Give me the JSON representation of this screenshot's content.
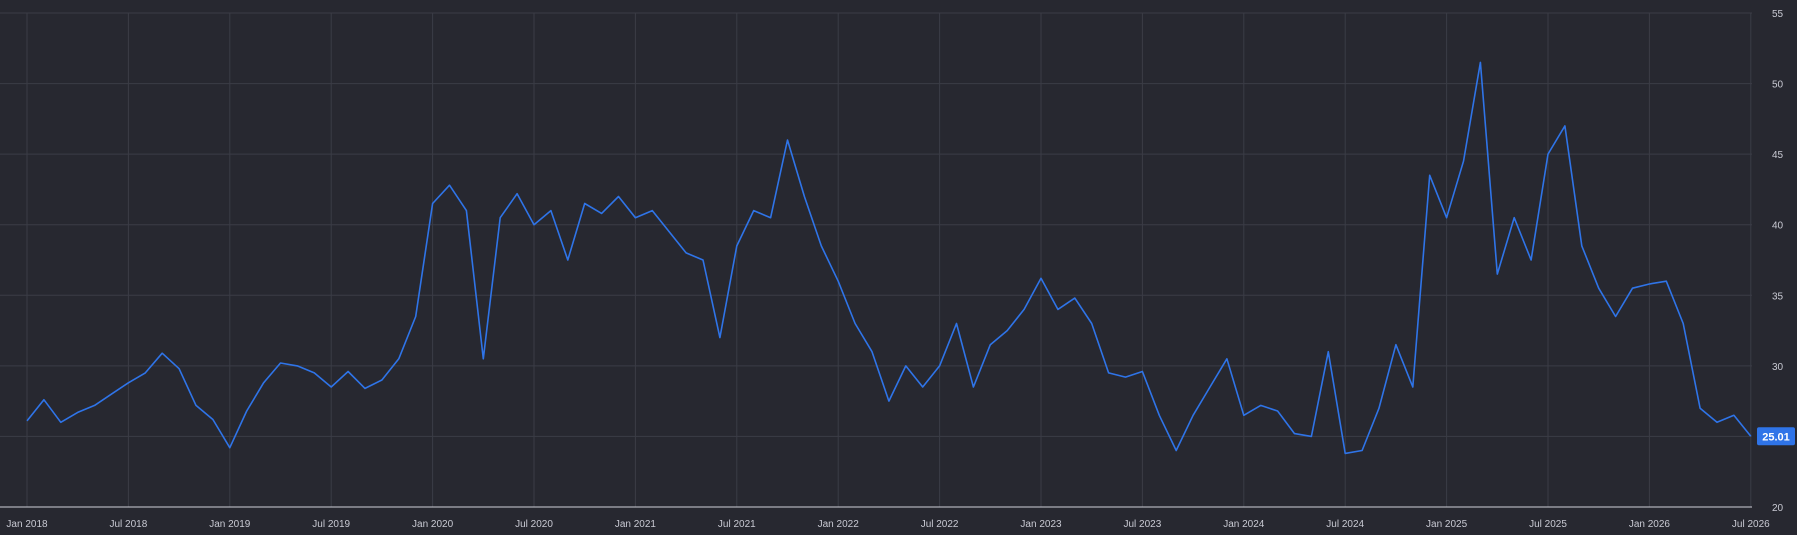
{
  "chart_data": {
    "type": "line",
    "colors": {
      "background": "#272830",
      "line": "#2f74e8",
      "grid": "#3b3c46",
      "badge": "#2f74e8"
    },
    "grid": true,
    "y_axis_position": "right",
    "ylim": [
      20,
      55
    ],
    "y_ticks": [
      "20",
      "25",
      "30",
      "35",
      "40",
      "45",
      "50",
      "55"
    ],
    "x_ticks": [
      "Jan 2018",
      "Jul 2018",
      "Jan 2019",
      "Jul 2019",
      "Jan 2020",
      "Jul 2020",
      "Jan 2021",
      "Jul 2021",
      "Jan 2022",
      "Jul 2022",
      "Jan 2023",
      "Jul 2023",
      "Jan 2024",
      "Jul 2024",
      "Jan 2025",
      "Jul 2025",
      "Jan 2026",
      "Jul 2026"
    ],
    "last_value_label": "25.01",
    "series": [
      {
        "values": [
          [
            "2018-01",
            26.1
          ],
          [
            "2018-02",
            27.6
          ],
          [
            "2018-03",
            26.0
          ],
          [
            "2018-04",
            26.7
          ],
          [
            "2018-05",
            27.2
          ],
          [
            "2018-06",
            28.0
          ],
          [
            "2018-07",
            28.8
          ],
          [
            "2018-08",
            29.5
          ],
          [
            "2018-09",
            30.9
          ],
          [
            "2018-10",
            29.8
          ],
          [
            "2018-11",
            27.2
          ],
          [
            "2018-12",
            26.2
          ],
          [
            "2019-01",
            24.2
          ],
          [
            "2019-02",
            26.8
          ],
          [
            "2019-03",
            28.8
          ],
          [
            "2019-04",
            30.2
          ],
          [
            "2019-05",
            30.0
          ],
          [
            "2019-06",
            29.5
          ],
          [
            "2019-07",
            28.5
          ],
          [
            "2019-08",
            29.6
          ],
          [
            "2019-09",
            28.4
          ],
          [
            "2019-10",
            29.0
          ],
          [
            "2019-11",
            30.5
          ],
          [
            "2019-12",
            33.5
          ],
          [
            "2020-01",
            41.5
          ],
          [
            "2020-02",
            42.8
          ],
          [
            "2020-03",
            41.0
          ],
          [
            "2020-04",
            30.5
          ],
          [
            "2020-05",
            40.5
          ],
          [
            "2020-06",
            42.2
          ],
          [
            "2020-07",
            40.0
          ],
          [
            "2020-08",
            41.0
          ],
          [
            "2020-09",
            37.5
          ],
          [
            "2020-10",
            41.5
          ],
          [
            "2020-11",
            40.8
          ],
          [
            "2020-12",
            42.0
          ],
          [
            "2021-01",
            40.5
          ],
          [
            "2021-02",
            41.0
          ],
          [
            "2021-03",
            39.5
          ],
          [
            "2021-04",
            38.0
          ],
          [
            "2021-05",
            37.5
          ],
          [
            "2021-06",
            32.0
          ],
          [
            "2021-07",
            38.5
          ],
          [
            "2021-08",
            41.0
          ],
          [
            "2021-09",
            40.5
          ],
          [
            "2021-10",
            46.0
          ],
          [
            "2021-11",
            42.0
          ],
          [
            "2021-12",
            38.5
          ],
          [
            "2022-01",
            36.0
          ],
          [
            "2022-02",
            33.0
          ],
          [
            "2022-03",
            31.0
          ],
          [
            "2022-04",
            27.5
          ],
          [
            "2022-05",
            30.0
          ],
          [
            "2022-06",
            28.5
          ],
          [
            "2022-07",
            30.0
          ],
          [
            "2022-08",
            33.0
          ],
          [
            "2022-09",
            28.5
          ],
          [
            "2022-10",
            31.5
          ],
          [
            "2022-11",
            32.5
          ],
          [
            "2022-12",
            34.0
          ],
          [
            "2023-01",
            36.2
          ],
          [
            "2023-02",
            34.0
          ],
          [
            "2023-03",
            34.8
          ],
          [
            "2023-04",
            33.0
          ],
          [
            "2023-05",
            29.5
          ],
          [
            "2023-06",
            29.2
          ],
          [
            "2023-07",
            29.6
          ],
          [
            "2023-08",
            26.5
          ],
          [
            "2023-09",
            24.0
          ],
          [
            "2023-10",
            26.5
          ],
          [
            "2023-11",
            28.5
          ],
          [
            "2023-12",
            30.5
          ],
          [
            "2024-01",
            26.5
          ],
          [
            "2024-02",
            27.2
          ],
          [
            "2024-03",
            26.8
          ],
          [
            "2024-04",
            25.2
          ],
          [
            "2024-05",
            25.0
          ],
          [
            "2024-06",
            31.0
          ],
          [
            "2024-07",
            23.8
          ],
          [
            "2024-08",
            24.0
          ],
          [
            "2024-09",
            27.0
          ],
          [
            "2024-10",
            31.5
          ],
          [
            "2024-11",
            28.5
          ],
          [
            "2024-12",
            43.5
          ],
          [
            "2025-01",
            40.5
          ],
          [
            "2025-02",
            44.5
          ],
          [
            "2025-03",
            51.5
          ],
          [
            "2025-04",
            36.5
          ],
          [
            "2025-05",
            40.5
          ],
          [
            "2025-06",
            37.5
          ],
          [
            "2025-07",
            45.0
          ],
          [
            "2025-08",
            47.0
          ],
          [
            "2025-09",
            38.5
          ],
          [
            "2025-10",
            35.5
          ],
          [
            "2025-11",
            33.5
          ],
          [
            "2025-12",
            35.5
          ],
          [
            "2026-01",
            35.8
          ],
          [
            "2026-02",
            36.0
          ],
          [
            "2026-03",
            33.0
          ],
          [
            "2026-04",
            27.0
          ],
          [
            "2026-05",
            26.0
          ],
          [
            "2026-06",
            26.5
          ],
          [
            "2026-07",
            25.01
          ]
        ]
      }
    ]
  }
}
